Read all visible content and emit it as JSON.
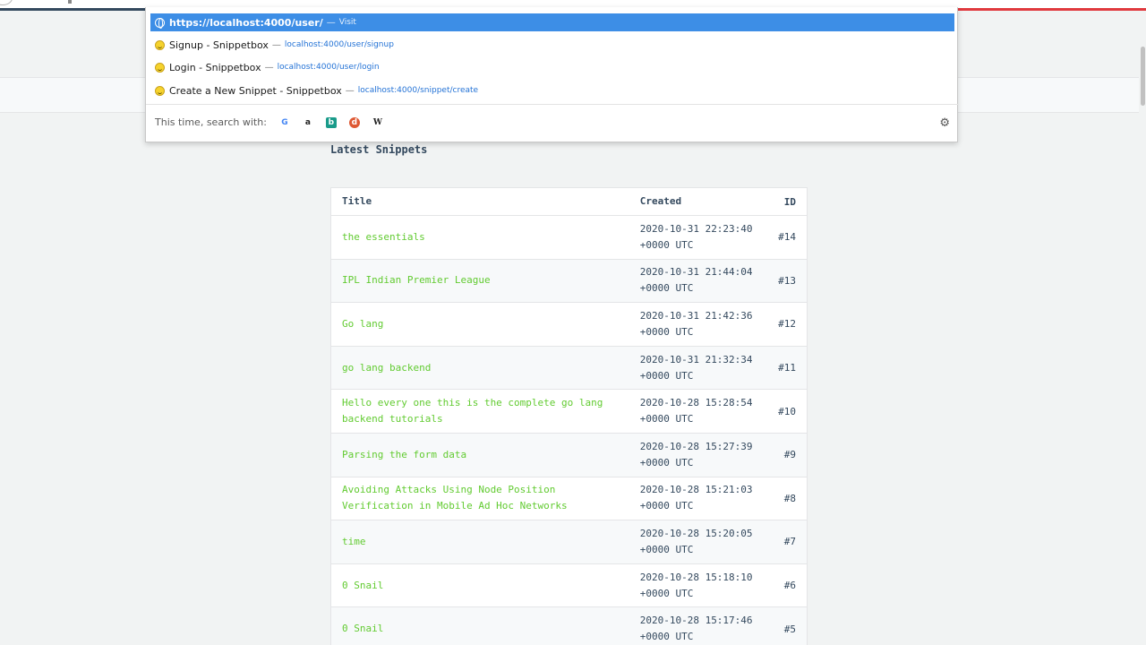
{
  "dropdown": {
    "selected": {
      "url": "https://localhost:4000/user/",
      "sep": "—",
      "action": "Visit"
    },
    "suggestions": [
      {
        "title": "Signup - Snippetbox",
        "sep": "—",
        "url": "localhost:4000/user/signup"
      },
      {
        "title": "Login - Snippetbox",
        "sep": "—",
        "url": "localhost:4000/user/login"
      },
      {
        "title": "Create a New Snippet - Snippetbox",
        "sep": "—",
        "url": "localhost:4000/snippet/create"
      }
    ],
    "search_label": "This time, search with:",
    "engines": [
      "G",
      "a",
      "b",
      "d",
      "W"
    ]
  },
  "main": {
    "heading": "Latest Snippets",
    "columns": {
      "title": "Title",
      "created": "Created",
      "id": "ID"
    },
    "rows": [
      {
        "title": "the essentials",
        "created1": "2020-10-31 22:23:40",
        "created2": "+0000 UTC",
        "id": "#14"
      },
      {
        "title": "IPL Indian Premier League",
        "created1": "2020-10-31 21:44:04",
        "created2": "+0000 UTC",
        "id": "#13"
      },
      {
        "title": "Go lang",
        "created1": "2020-10-31 21:42:36",
        "created2": "+0000 UTC",
        "id": "#12"
      },
      {
        "title": "go lang backend",
        "created1": "2020-10-31 21:32:34",
        "created2": "+0000 UTC",
        "id": "#11"
      },
      {
        "title": "Hello every one this is the complete go lang backend tutorials",
        "created1": "2020-10-28 15:28:54",
        "created2": "+0000 UTC",
        "id": "#10"
      },
      {
        "title": "Parsing the form data",
        "created1": "2020-10-28 15:27:39",
        "created2": "+0000 UTC",
        "id": "#9"
      },
      {
        "title": "Avoiding Attacks Using Node Position Verification in Mobile Ad Hoc Networks",
        "created1": "2020-10-28 15:21:03",
        "created2": "+0000 UTC",
        "id": "#8"
      },
      {
        "title": "time",
        "created1": "2020-10-28 15:20:05",
        "created2": "+0000 UTC",
        "id": "#7"
      },
      {
        "title": "0 Snail",
        "created1": "2020-10-28 15:18:10",
        "created2": "+0000 UTC",
        "id": "#6"
      },
      {
        "title": "0 Snail",
        "created1": "2020-10-28 15:17:46",
        "created2": "+0000 UTC",
        "id": "#5"
      }
    ]
  },
  "colors": {
    "link": "#62cb31",
    "text": "#34495e",
    "selected_bg": "#3d8ee6"
  }
}
